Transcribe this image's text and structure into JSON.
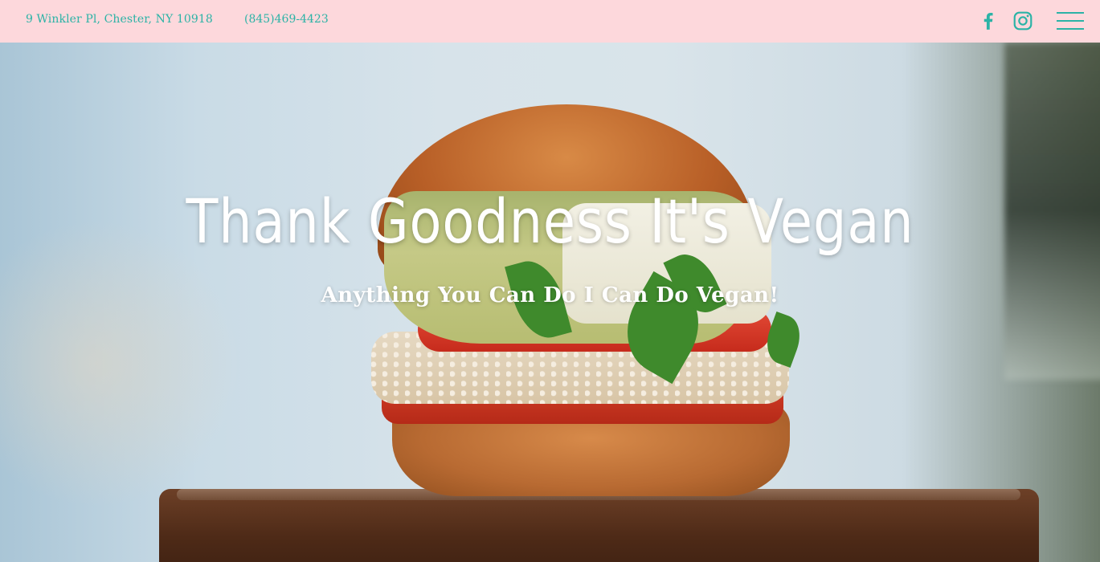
{
  "header": {
    "address": "9 Winkler Pl, Chester, NY 10918",
    "phone": "(845)469-4423",
    "accent_color": "#2bb3a6",
    "background_color": "#fdd8dc",
    "icons": [
      "facebook-icon",
      "instagram-icon",
      "hamburger-menu-icon"
    ]
  },
  "hero": {
    "title": "Thank Goodness It's Vegan",
    "subtitle": "Anything You Can Do I Can Do Vegan!",
    "background_image": "veggie-burger-photo"
  }
}
